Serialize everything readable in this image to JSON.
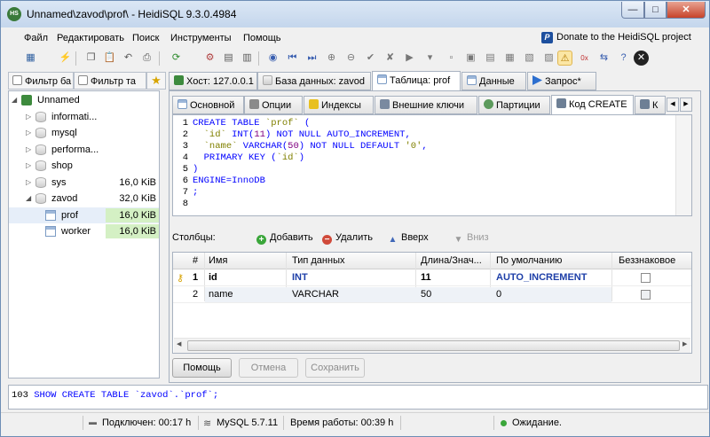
{
  "window": {
    "title": "Unnamed\\zavod\\prof\\ - HeidiSQL 9.3.0.4984",
    "app_icon_text": "HS",
    "minimize": "—",
    "maximize": "□",
    "close": "✕"
  },
  "menu": [
    "Файл",
    "Редактировать",
    "Поиск",
    "Инструменты",
    "Помощь"
  ],
  "donate": {
    "logo": "P",
    "label": "Donate to the HeidiSQL project"
  },
  "left_tabs": [
    "Фильтр ба",
    "Фильтр та"
  ],
  "tree": [
    {
      "label": "Unnamed",
      "size": "",
      "icon": "server-icon",
      "expanded": true
    },
    {
      "label": "informati...",
      "size": "",
      "icon": "database-icon"
    },
    {
      "label": "mysql",
      "size": "",
      "icon": "database-icon"
    },
    {
      "label": "performa...",
      "size": "",
      "icon": "database-icon"
    },
    {
      "label": "shop",
      "size": "",
      "icon": "database-icon"
    },
    {
      "label": "sys",
      "size": "16,0 KiB",
      "icon": "database-icon"
    },
    {
      "label": "zavod",
      "size": "32,0 KiB",
      "icon": "database-icon",
      "expanded": true
    },
    {
      "label": "prof",
      "size": "16,0 KiB",
      "icon": "table-icon",
      "selected": true
    },
    {
      "label": "worker",
      "size": "16,0 KiB",
      "icon": "table-icon"
    }
  ],
  "top_tabs": [
    {
      "label": "Хост: 127.0.0.1",
      "icon": "server-icon"
    },
    {
      "label": "База данных: zavod",
      "icon": "database-icon"
    },
    {
      "label": "Таблица: prof",
      "icon": "table-icon",
      "active": true
    },
    {
      "label": "Данные",
      "icon": "data-icon"
    },
    {
      "label": "Запрос*",
      "icon": "play-icon"
    }
  ],
  "sub_tabs": [
    {
      "label": "Основной",
      "icon": "table-icon"
    },
    {
      "label": "Опции",
      "icon": "wrench-icon"
    },
    {
      "label": "Индексы",
      "icon": "lightning-icon"
    },
    {
      "label": "Внешние ключи",
      "icon": "link-icon"
    },
    {
      "label": "Партиции",
      "icon": "globe-icon"
    },
    {
      "label": "Код CREATE",
      "icon": "code-icon",
      "active": true
    },
    {
      "label": "К",
      "icon": "code-icon"
    }
  ],
  "code_lines": [
    {
      "n": "1",
      "text": "CREATE TABLE `prof` ("
    },
    {
      "n": "2",
      "text": "  `id` INT(11) NOT NULL AUTO_INCREMENT,"
    },
    {
      "n": "3",
      "text": "  `name` VARCHAR(50) NOT NULL DEFAULT '0',"
    },
    {
      "n": "4",
      "text": "  PRIMARY KEY (`id`)"
    },
    {
      "n": "5",
      "text": ")"
    },
    {
      "n": "6",
      "text": "ENGINE=InnoDB"
    },
    {
      "n": "7",
      "text": ";"
    },
    {
      "n": "8",
      "text": ""
    }
  ],
  "columns_bar": {
    "label": "Столбцы:",
    "add": "Добавить",
    "remove": "Удалить",
    "up": "Вверх",
    "down": "Вниз"
  },
  "grid": {
    "headers": [
      "#",
      "Имя",
      "Тип данных",
      "Длина/Знач...",
      "По умолчанию",
      "Беззнаковое"
    ],
    "rows": [
      {
        "num": "1",
        "name": "id",
        "type": "INT",
        "length": "11",
        "default": "AUTO_INCREMENT",
        "unsigned": false,
        "primary": true
      },
      {
        "num": "2",
        "name": "name",
        "type": "VARCHAR",
        "length": "50",
        "default": "0",
        "unsigned": false,
        "primary": false
      }
    ]
  },
  "buttons": {
    "help": "Помощь",
    "cancel": "Отмена",
    "save": "Сохранить"
  },
  "log": {
    "line": "103",
    "text": "SHOW CREATE TABLE `zavod`.`prof`;"
  },
  "status": {
    "connected": "Подключен: 00:17 h",
    "server": "MySQL 5.7.11",
    "uptime": "Время работы: 00:39 h",
    "state": "Ожидание."
  }
}
